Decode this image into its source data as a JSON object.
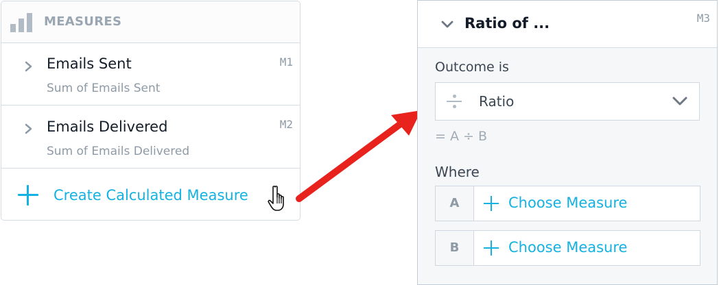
{
  "measures_panel": {
    "title": "MEASURES",
    "items": [
      {
        "name": "Emails Sent",
        "subtitle": "Sum of Emails Sent",
        "id": "M1"
      },
      {
        "name": "Emails Delivered",
        "subtitle": "Sum of Emails Delivered",
        "id": "M2"
      }
    ],
    "create_label": "Create Calculated Measure"
  },
  "ratio_panel": {
    "title": "Ratio of ...",
    "id": "M3",
    "outcome_label": "Outcome is",
    "outcome_value": "Ratio",
    "formula": "= A ÷ B",
    "where_label": "Where",
    "slots": [
      {
        "letter": "A",
        "label": "Choose Measure"
      },
      {
        "letter": "B",
        "label": "Choose Measure"
      }
    ]
  },
  "colors": {
    "accent": "#14b2e2",
    "arrow": "#e8221c",
    "muted": "#8e9aa6",
    "border": "#d4dbe3"
  },
  "icons": [
    "bar-chart-icon",
    "chevron-right-icon",
    "plus-icon",
    "hand-pointer-icon",
    "chevron-down-icon",
    "divide-icon"
  ]
}
